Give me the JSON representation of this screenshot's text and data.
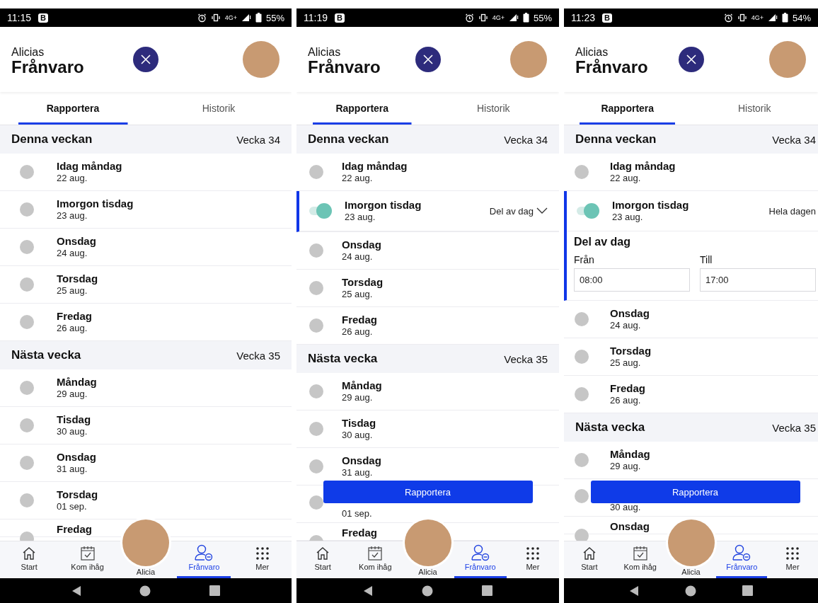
{
  "phones": [
    {
      "status_bar": {
        "time": "11:15",
        "badge": "B",
        "network": "4G+",
        "battery": "55%"
      },
      "header": {
        "subtitle": "Alicias",
        "title": "Frånvaro"
      },
      "tabs": [
        {
          "label": "Rapportera",
          "selected": true
        },
        {
          "label": "Historik",
          "selected": false
        }
      ],
      "sections": [
        {
          "title": "Denna veckan",
          "week": "Vecka 34",
          "days": [
            {
              "title": "Idag måndag",
              "date": "22 aug.",
              "on": false
            },
            {
              "title": "Imorgon tisdag",
              "date": "23 aug.",
              "on": false
            },
            {
              "title": "Onsdag",
              "date": "24 aug.",
              "on": false
            },
            {
              "title": "Torsdag",
              "date": "25 aug.",
              "on": false
            },
            {
              "title": "Fredag",
              "date": "26 aug.",
              "on": false
            }
          ]
        },
        {
          "title": "Nästa vecka",
          "week": "Vecka 35",
          "days": [
            {
              "title": "Måndag",
              "date": "29 aug.",
              "on": false
            },
            {
              "title": "Tisdag",
              "date": "30 aug.",
              "on": false
            },
            {
              "title": "Onsdag",
              "date": "31 aug.",
              "on": false
            },
            {
              "title": "Torsdag",
              "date": "01 sep.",
              "on": false
            },
            {
              "title": "Fredag",
              "on": false
            }
          ]
        }
      ],
      "bottom_nav": [
        {
          "kind": "home",
          "label": "Start",
          "selected": false
        },
        {
          "kind": "calendar",
          "label": "Kom ihåg",
          "selected": false
        },
        {
          "kind": "avatar",
          "label": "Alicia",
          "selected": false
        },
        {
          "kind": "absence",
          "label": "Frånvaro",
          "selected": true
        },
        {
          "kind": "more",
          "label": "Mer",
          "selected": false
        }
      ]
    },
    {
      "status_bar": {
        "time": "11:19",
        "badge": "B",
        "network": "4G+",
        "battery": "55%"
      },
      "header": {
        "subtitle": "Alicias",
        "title": "Frånvaro"
      },
      "tabs": [
        {
          "label": "Rapportera",
          "selected": true
        },
        {
          "label": "Historik",
          "selected": false
        }
      ],
      "sections": [
        {
          "title": "Denna veckan",
          "week": "Vecka 34",
          "days": [
            {
              "title": "Idag måndag",
              "date": "22 aug.",
              "on": false
            },
            {
              "title": "Imorgon tisdag",
              "date": "23 aug.",
              "on": true,
              "option": {
                "label": "Del av dag",
                "dropdown": true
              }
            },
            {
              "title": "Onsdag",
              "date": "24 aug.",
              "on": false
            },
            {
              "title": "Torsdag",
              "date": "25 aug.",
              "on": false
            },
            {
              "title": "Fredag",
              "date": "26 aug.",
              "on": false
            }
          ]
        },
        {
          "title": "Nästa vecka",
          "week": "Vecka 35",
          "days": [
            {
              "title": "Måndag",
              "date": "29 aug.",
              "on": false
            },
            {
              "title": "Tisdag",
              "date": "30 aug.",
              "on": false
            },
            {
              "title": "Onsdag",
              "date": "31 aug.",
              "on": false
            },
            {
              "date": "01 sep.",
              "on": false
            },
            {
              "title": "Fredag",
              "on": false
            }
          ]
        }
      ],
      "floating_button": "Rapportera",
      "bottom_nav": [
        {
          "kind": "home",
          "label": "Start",
          "selected": false
        },
        {
          "kind": "calendar",
          "label": "Kom ihåg",
          "selected": false
        },
        {
          "kind": "avatar",
          "label": "Alicia",
          "selected": false
        },
        {
          "kind": "absence",
          "label": "Frånvaro",
          "selected": true
        },
        {
          "kind": "more",
          "label": "Mer",
          "selected": false
        }
      ]
    },
    {
      "status_bar": {
        "time": "11:23",
        "badge": "B",
        "network": "4G+",
        "battery": "54%"
      },
      "header": {
        "subtitle": "Alicias",
        "title": "Frånvaro"
      },
      "tabs": [
        {
          "label": "Rapportera",
          "selected": true
        },
        {
          "label": "Historik",
          "selected": false
        }
      ],
      "sections": [
        {
          "title": "Denna veckan",
          "week": "Vecka 34",
          "days": [
            {
              "title": "Idag måndag",
              "date": "22 aug.",
              "on": false
            },
            {
              "title": "Imorgon tisdag",
              "date": "23 aug.",
              "on": true,
              "option": {
                "label": "Hela dagen",
                "dropdown": false
              },
              "detail": {
                "title": "Del av dag",
                "from_label": "Från",
                "from": "08:00",
                "to_label": "Till",
                "to": "17:00"
              }
            },
            {
              "title": "Onsdag",
              "date": "24 aug.",
              "on": false
            },
            {
              "title": "Torsdag",
              "date": "25 aug.",
              "on": false
            },
            {
              "title": "Fredag",
              "date": "26 aug.",
              "on": false
            }
          ]
        },
        {
          "title": "Nästa vecka",
          "week": "Vecka 35",
          "days": [
            {
              "title": "Måndag",
              "date": "29 aug.",
              "on": false
            },
            {
              "date": "30 aug.",
              "on": false
            },
            {
              "title": "Onsdag",
              "on": false
            }
          ]
        }
      ],
      "floating_button": "Rapportera",
      "bottom_nav": [
        {
          "kind": "home",
          "label": "Start",
          "selected": false
        },
        {
          "kind": "calendar",
          "label": "Kom ihåg",
          "selected": false
        },
        {
          "kind": "avatar",
          "label": "Alicia",
          "selected": false
        },
        {
          "kind": "absence",
          "label": "Frånvaro",
          "selected": true
        },
        {
          "kind": "more",
          "label": "Mer",
          "selected": false
        }
      ]
    }
  ]
}
